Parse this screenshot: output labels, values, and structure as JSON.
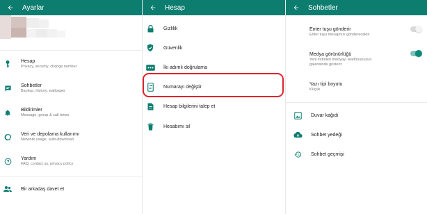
{
  "colors": {
    "accent": "#0d7d6f",
    "icon": "#0d7d6f",
    "highlight": "#e0232b"
  },
  "panel_settings": {
    "title": "Ayarlar",
    "items": [
      {
        "label": "Hesap",
        "sub": "Privacy, security, change number",
        "icon": "key-icon"
      },
      {
        "label": "Sohbetler",
        "sub": "Backup, history, wallpaper",
        "icon": "chat-icon"
      },
      {
        "label": "Bildirimler",
        "sub": "Message, group & call tones",
        "icon": "bell-icon"
      },
      {
        "label": "Veri ve depolama kullanımı",
        "sub": "Network usage, auto-download",
        "icon": "data-usage-icon"
      },
      {
        "label": "Yardım",
        "sub": "FAQ, contact us, privacy policy",
        "icon": "help-icon"
      }
    ],
    "invite_label": "Bir arkadaş davet et"
  },
  "panel_account": {
    "title": "Hesap",
    "items": [
      {
        "label": "Gizlilik",
        "icon": "lock-icon"
      },
      {
        "label": "Güvenlik",
        "icon": "shield-icon"
      },
      {
        "label": "İki adımlı doğrulama",
        "icon": "dots-icon"
      },
      {
        "label": "Numarayı değiştir",
        "icon": "phone-change-icon"
      },
      {
        "label": "Hesap bilgilerini talep et",
        "icon": "document-icon"
      },
      {
        "label": "Hesabımı sil",
        "icon": "trash-icon"
      }
    ]
  },
  "panel_chats": {
    "title": "Sohbetler",
    "enter_label": "Enter tuşu gönderir",
    "enter_sub": "Enter tuşu mesajınızı gönderecektir",
    "enter_on": false,
    "media_label": "Medya görünürlüğü",
    "media_sub_1": "Yeni indirilen medyayı telefonunuzun",
    "media_sub_2": "galerisinde gösterir",
    "media_on": true,
    "font_label": "Yazı tipi boyutu",
    "font_value": "Küçük",
    "links": [
      {
        "label": "Duvar kağıdı",
        "icon": "wallpaper-icon"
      },
      {
        "label": "Sohbet yedeği",
        "icon": "cloud-upload-icon"
      },
      {
        "label": "Sohbet geçmişi",
        "icon": "history-icon"
      }
    ]
  }
}
